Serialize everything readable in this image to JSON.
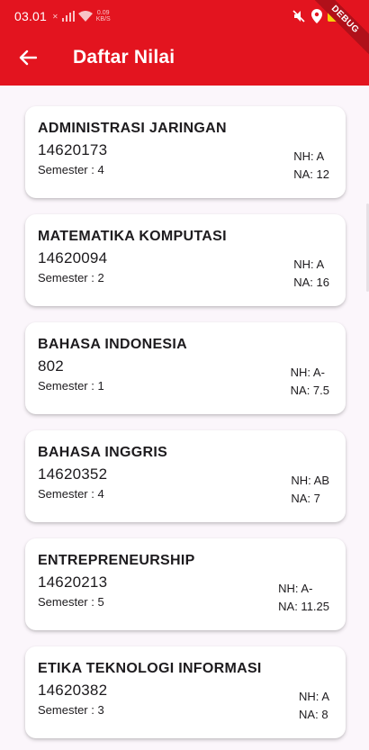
{
  "status_bar": {
    "time": "03.01",
    "network_speed_value": "0.09",
    "network_speed_unit": "KB/S",
    "debug_label": "DEBUG"
  },
  "app_bar": {
    "title": "Daftar Nilai",
    "background": "#e3141f"
  },
  "courses": [
    {
      "name": "ADMINISTRASI JARINGAN",
      "code": "14620173",
      "semester": "Semester : 4",
      "nh": "NH: A",
      "na": "NA: 12"
    },
    {
      "name": "MATEMATIKA KOMPUTASI",
      "code": "14620094",
      "semester": "Semester : 2",
      "nh": "NH: A",
      "na": "NA: 16"
    },
    {
      "name": "BAHASA INDONESIA",
      "code": "802",
      "semester": "Semester : 1",
      "nh": "NH: A-",
      "na": "NA: 7.5"
    },
    {
      "name": "BAHASA INGGRIS",
      "code": "14620352",
      "semester": "Semester : 4",
      "nh": "NH: AB",
      "na": "NA: 7"
    },
    {
      "name": "ENTREPRENEURSHIP",
      "code": "14620213",
      "semester": "Semester : 5",
      "nh": "NH: A-",
      "na": "NA: 11.25"
    },
    {
      "name": "ETIKA TEKNOLOGI INFORMASI",
      "code": "14620382",
      "semester": "Semester : 3",
      "nh": "NH: A",
      "na": "NA: 8"
    }
  ]
}
